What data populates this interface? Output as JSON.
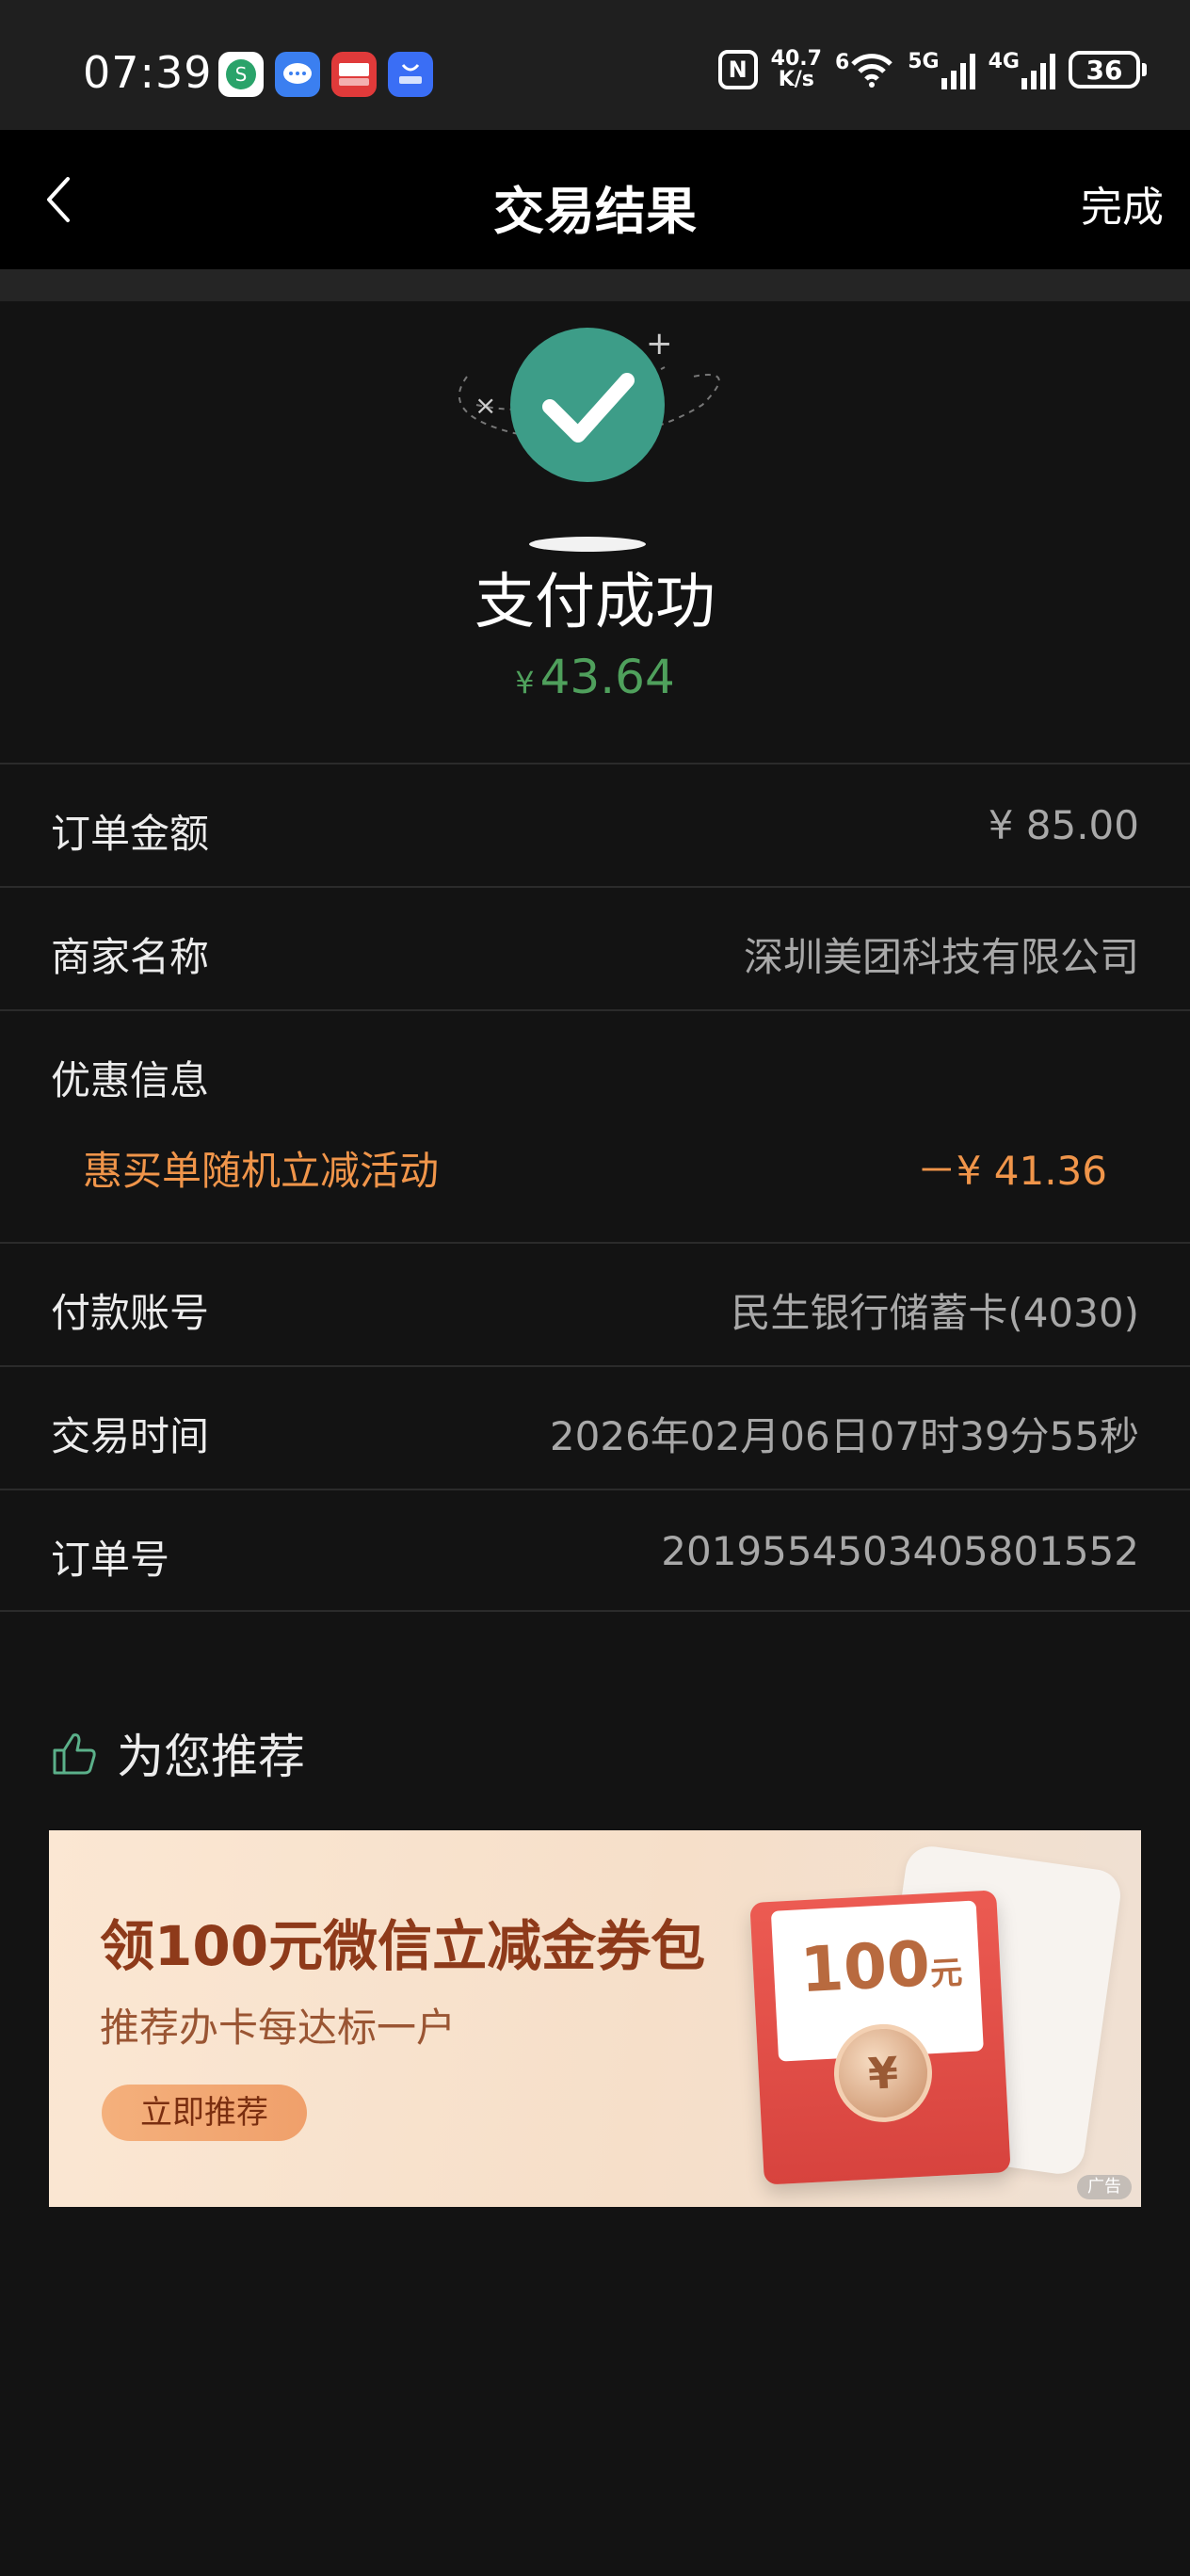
{
  "status_bar": {
    "time": "07:39",
    "net_speed_value": "40.7",
    "net_speed_unit": "K/s",
    "wifi_label": "6",
    "signal_1": "5G",
    "signal_2": "4G",
    "battery": "36",
    "nfc": "N",
    "app_icons": [
      "app-icon-1",
      "app-icon-2",
      "app-icon-3",
      "app-market-icon"
    ]
  },
  "nav": {
    "title": "交易结果",
    "done_label": "完成"
  },
  "result": {
    "title": "支付成功",
    "currency": "¥",
    "amount": "43.64"
  },
  "details": {
    "order_amount_label": "订单金额",
    "order_amount_value": "¥ 85.00",
    "merchant_label": "商家名称",
    "merchant_value": "深圳美团科技有限公司",
    "discount_label": "优惠信息",
    "discount_name": "惠买单随机立减活动",
    "discount_value": "－¥ 41.36",
    "account_label": "付款账号",
    "account_value": "民生银行储蓄卡(4030)",
    "time_label": "交易时间",
    "time_value": "2026年02月06日07时39分55秒",
    "order_no_label": "订单号",
    "order_no_value": "2019554503405801552"
  },
  "recommend": {
    "title": "为您推荐",
    "banner_title": "领100元微信立减金券包",
    "banner_sub": "推荐办卡每达标一户",
    "banner_button": "立即推荐",
    "card_value": "100",
    "card_unit": "元",
    "coin_symbol": "¥",
    "ad_label": "广告"
  },
  "colors": {
    "background": "#131313",
    "success_green": "#4fa05c",
    "discount_orange": "#f0954a",
    "nav_bg": "#000000"
  }
}
